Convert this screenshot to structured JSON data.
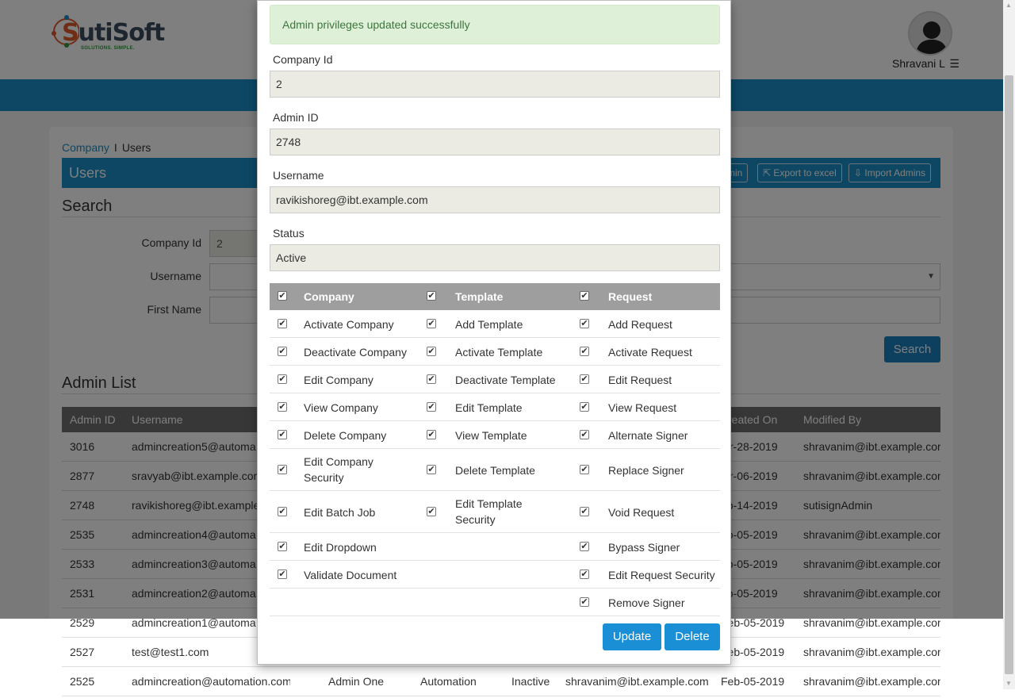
{
  "brand": {
    "name_s": "S",
    "name_rest": "utiSoft",
    "tagline": "SOLUTIONS. SIMPLE."
  },
  "user": {
    "name": "Shravani L",
    "menu_icon": "☰"
  },
  "breadcrumb": {
    "parent": "Company",
    "separator": "I",
    "current": "Users"
  },
  "users_bar": {
    "title": "Users",
    "add_admin_partial": "min",
    "export_label": "Export to excel",
    "import_label": "Import Admins"
  },
  "search": {
    "title": "Search",
    "company_id_label": "Company Id",
    "company_id_value": "2",
    "username_label": "Username",
    "first_name_label": "First Name",
    "search_button": "Search"
  },
  "admin_list": {
    "title": "Admin List",
    "columns": [
      "Admin ID",
      "Username",
      "reated On",
      "Modified By"
    ],
    "rows": [
      {
        "id": "3016",
        "username": "admincreation5@automa",
        "first": "",
        "last": "",
        "status": "",
        "created_by": "",
        "created": "lar-28-2019",
        "modified": "shravanim@ibt.example.com"
      },
      {
        "id": "2877",
        "username": "sravyab@ibt.example.com",
        "first": "",
        "last": "",
        "status": "",
        "created_by": "",
        "created": "lar-06-2019",
        "modified": "shravanim@ibt.example.com"
      },
      {
        "id": "2748",
        "username": "ravikishoreg@ibt.example",
        "first": "",
        "last": "",
        "status": "",
        "created_by": "",
        "created": "eb-14-2019",
        "modified": "sutisignAdmin"
      },
      {
        "id": "2535",
        "username": "admincreation4@automa",
        "first": "",
        "last": "",
        "status": "",
        "created_by": "",
        "created": "eb-05-2019",
        "modified": "shravanim@ibt.example.com"
      },
      {
        "id": "2533",
        "username": "admincreation3@automa",
        "first": "",
        "last": "",
        "status": "",
        "created_by": "",
        "created": "eb-05-2019",
        "modified": "shravanim@ibt.example.com"
      },
      {
        "id": "2531",
        "username": "admincreation2@automa",
        "first": "",
        "last": "",
        "status": "",
        "created_by": "",
        "created": "eb-05-2019",
        "modified": "shravanim@ibt.example.com"
      },
      {
        "id": "2529",
        "username": "admincreation1@automa",
        "first": "",
        "last": "",
        "status": "",
        "created_by": "",
        "created": "Feb-05-2019",
        "modified": "shravanim@ibt.example.com"
      },
      {
        "id": "2527",
        "username": "test@test1.com",
        "first": "",
        "last": "",
        "status": "",
        "created_by": "",
        "created": "Feb-05-2019",
        "modified": "shravanim@ibt.example.com"
      },
      {
        "id": "2525",
        "username": "admincreation@automation.com",
        "first": "Admin One",
        "last": "Automation",
        "status": "Inactive",
        "created_by": "shravanim@ibt.example.com",
        "created": "Feb-05-2019",
        "modified": "shravanim@ibt.example.com"
      }
    ]
  },
  "modal": {
    "alert": "Admin privileges updated successfully",
    "company_id_label": "Company Id",
    "company_id_value": "2",
    "admin_id_label": "Admin ID",
    "admin_id_value": "2748",
    "username_label": "Username",
    "username_value": "ravikishoreg@ibt.example.com",
    "status_label": "Status",
    "status_value": "Active",
    "check_glyph": "✔",
    "headers": [
      "Company",
      "Template",
      "Request"
    ],
    "company_perms": [
      "Activate Company",
      "Deactivate Company",
      "Edit Company",
      "View Company",
      "Delete Company",
      "Edit Company Security",
      "Edit Batch Job",
      "Edit Dropdown",
      "Validate Document"
    ],
    "template_perms": [
      "Add Template",
      "Activate Template",
      "Deactivate Template",
      "Edit Template",
      "View Template",
      "Delete Template",
      "Edit Template Security"
    ],
    "request_perms": [
      "Add Request",
      "Activate Request",
      "Edit Request",
      "View Request",
      "Alternate Signer",
      "Replace Signer",
      "Void Request",
      "Bypass Signer",
      "Edit Request Security",
      "Remove Signer"
    ],
    "update_button": "Update",
    "delete_button": "Delete"
  },
  "colors": {
    "primary": "#1a8fc9",
    "alert_bg": "#dff0d8",
    "alert_text": "#3c763d",
    "table_header": "#6f6f6f",
    "perm_header": "#9e9e9e"
  }
}
